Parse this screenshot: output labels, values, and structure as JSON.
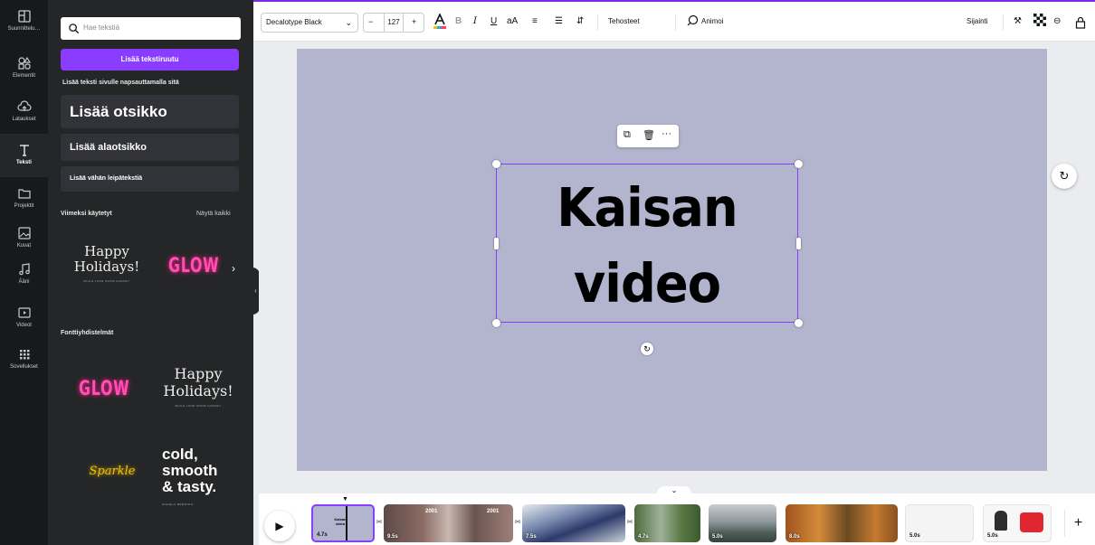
{
  "rail": {
    "items": [
      {
        "label": "Suunnittelu…",
        "icon": "layout-icon"
      },
      {
        "label": "Elementit",
        "icon": "shapes-icon"
      },
      {
        "label": "Lataukset",
        "icon": "cloud-upload-icon"
      },
      {
        "label": "Teksti",
        "icon": "text-icon",
        "active": true
      },
      {
        "label": "Projektit",
        "icon": "folder-icon"
      },
      {
        "label": "Kuvat",
        "icon": "image-icon"
      },
      {
        "label": "Ääni",
        "icon": "music-icon"
      },
      {
        "label": "Videot",
        "icon": "video-icon"
      },
      {
        "label": "Sovellukset",
        "icon": "apps-icon"
      }
    ]
  },
  "panel": {
    "search_placeholder": "Hae tekstiä",
    "add_textbox": "Lisää tekstiruutu",
    "hint": "Lisää teksti sivulle napsauttamalla sitä",
    "heading": "Lisää otsikko",
    "subheading": "Lisää alaotsikko",
    "body": "Lisää vähän leipätekstiä",
    "recent_title": "Viimeksi käytetyt",
    "show_all": "Näytä kaikki",
    "font_combos_title": "Fonttiyhdistelmät",
    "presets": {
      "happy_1": "Happy",
      "happy_2": "Holidays!",
      "happy_sub": "MUCH LOVE FROM HARVEY",
      "glow": "GLOW",
      "sparkle": "Sparkle",
      "cold_1": "cold,",
      "cold_2": "smooth",
      "cold_3": "& tasty.",
      "cold_sub": "ANGELO BREWING"
    }
  },
  "toolbar": {
    "font": "Decalotype Black",
    "size": "127",
    "minus": "−",
    "plus": "+",
    "effects": "Tehosteet",
    "animate": "Animoi",
    "position": "Sijainti"
  },
  "canvas": {
    "text_line1": "Kaisan",
    "text_line2": "video",
    "page_color": "#b3b5cf",
    "selection_color": "#8b3dff"
  },
  "timeline": {
    "clips": [
      {
        "duration": "4.7s",
        "label": "Kaisan video"
      },
      {
        "duration": "9.5s",
        "label": "2001"
      },
      {
        "duration": "7.5s"
      },
      {
        "duration": "4.7s"
      },
      {
        "duration": "5.0s"
      },
      {
        "duration": "8.0s"
      },
      {
        "duration": "5.0s"
      },
      {
        "duration": "5.0s"
      }
    ],
    "overlay_2001": "2001"
  },
  "colors": {
    "accent": "#8b3dff",
    "rail_bg": "#18191b",
    "panel_bg": "#252627",
    "glow_pink": "#ff4fb4",
    "sparkle_gold": "#f2c200"
  }
}
